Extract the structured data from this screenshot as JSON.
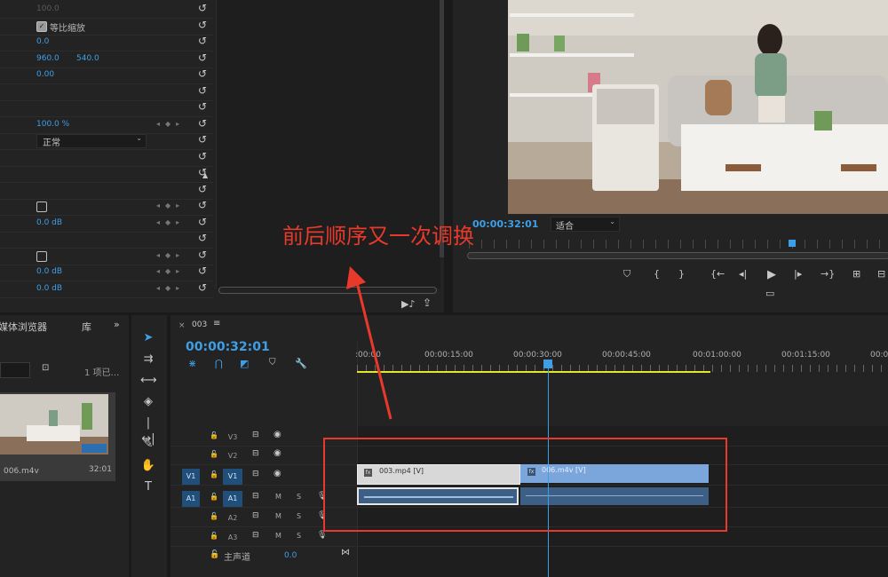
{
  "effect_controls": {
    "rows": [
      {
        "value": "100.0",
        "dim": true
      },
      {
        "checkbox": true,
        "checked": true,
        "label": "等比缩放"
      },
      {
        "value": "0.0"
      },
      {
        "value": "960.0",
        "value2": "540.0"
      },
      {
        "value": "0.00"
      },
      {
        "value": ""
      },
      {
        "value": ""
      },
      {
        "value": "100.0 %"
      },
      {
        "select": "正常"
      },
      {
        "value": ""
      },
      {
        "value": ""
      },
      {
        "value": ""
      },
      {
        "checkbox": true,
        "checked": false
      },
      {
        "value": "0.0 dB"
      },
      {
        "value": ""
      },
      {
        "checkbox": true,
        "checked": false
      },
      {
        "value": "0.0 dB"
      },
      {
        "value": "0.0 dB"
      }
    ]
  },
  "program_monitor": {
    "timecode": "00:00:32:01",
    "fit_label": "适合"
  },
  "annotation": {
    "text": "前后顺序又一次调换",
    "color": "#e8392b"
  },
  "project_panel": {
    "tab_label": "媒体浏览器",
    "tab_library": "库",
    "count_label": "1 项已…",
    "clip_name": "006.m4v",
    "clip_duration": "32:01"
  },
  "timeline": {
    "sequence_name": "003",
    "timecode": "00:00:32:01",
    "ruler_labels": [
      ":00:00",
      "00:00:15:00",
      "00:00:30:00",
      "00:00:45:00",
      "00:01:00:00",
      "00:01:15:00",
      "00:0"
    ],
    "video_tracks": [
      {
        "name": "V3"
      },
      {
        "name": "V2"
      },
      {
        "name": "V1",
        "source": "V1"
      }
    ],
    "audio_tracks": [
      {
        "name": "A1",
        "source": "A1"
      },
      {
        "name": "A2"
      },
      {
        "name": "A3"
      }
    ],
    "master_label": "主声道",
    "master_value": "0.0",
    "clips": [
      {
        "name": "003.mp4 [V]"
      },
      {
        "name": "006.m4v [V]"
      }
    ],
    "mute_label": "M",
    "solo_label": "S"
  },
  "colors": {
    "accent": "#3f9fe6",
    "highlight_box": "#e8392b",
    "clip_selected": "#d8d8d8",
    "clip_video": "#7aa6dc",
    "work_area": "#e5e52e"
  }
}
